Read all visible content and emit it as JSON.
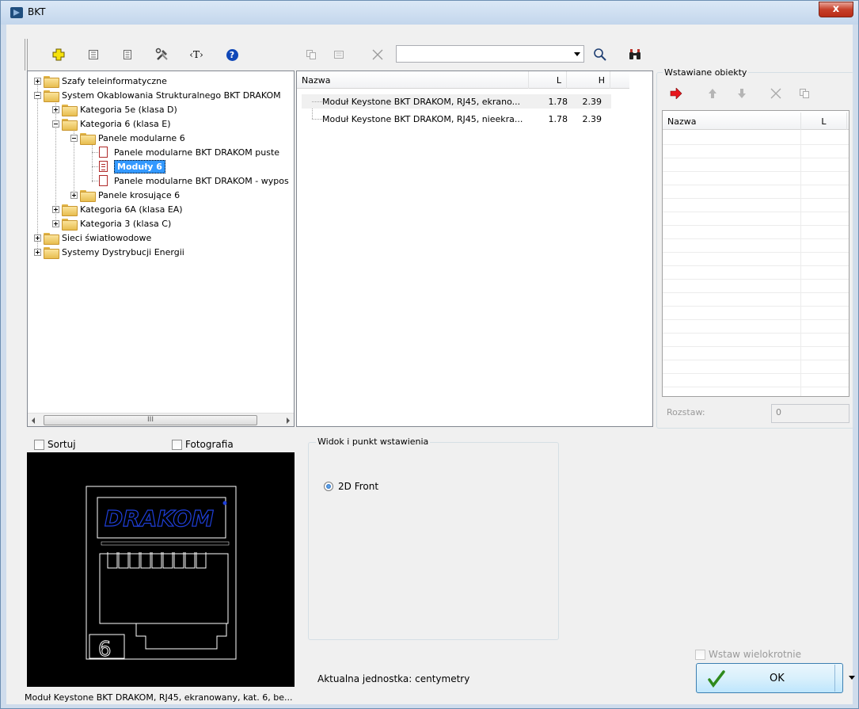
{
  "window": {
    "title": "BKT",
    "close_glyph": "x"
  },
  "toolbar": {
    "icons": [
      "add-icon",
      "list-view-icon",
      "details-icon",
      "tools-icon",
      "text-tag-icon",
      "help-icon",
      "copy-icon",
      "properties-icon",
      "delete-icon",
      "search-icon",
      "binoculars-icon"
    ],
    "text_tag": "‹T›",
    "help": "?",
    "search_value": ""
  },
  "tree": {
    "items": [
      {
        "label": "Szafy teleinformatyczne"
      },
      {
        "label": "System Okablowania Strukturalnego BKT DRAKOM"
      },
      {
        "label": "Kategoria 5e (klasa D)"
      },
      {
        "label": "Kategoria 6  (klasa E)"
      },
      {
        "label": "Panele modularne 6"
      },
      {
        "label": "Panele modularne BKT DRAKOM puste"
      },
      {
        "label": "Moduły 6"
      },
      {
        "label": "Panele modularne BKT DRAKOM - wypos"
      },
      {
        "label": "Panele krosujące 6"
      },
      {
        "label": "Kategoria 6A (klasa EA)"
      },
      {
        "label": "Kategoria 3 (klasa C)"
      },
      {
        "label": "Sieci światłowodowe"
      },
      {
        "label": "Systemy Dystrybucji Energii"
      }
    ],
    "scroll_thumb_glyph": "III"
  },
  "list": {
    "columns": [
      "Nazwa",
      "L",
      "H"
    ],
    "rows": [
      {
        "name": "Moduł Keystone BKT DRAKOM, RJ45, ekrano...",
        "l": "1.78",
        "h": "2.39"
      },
      {
        "name": "Moduł Keystone BKT DRAKOM, RJ45, nieekra...",
        "l": "1.78",
        "h": "2.39"
      }
    ]
  },
  "inserted": {
    "title": "Wstawiane obiekty",
    "columns": [
      "Nazwa",
      "L"
    ],
    "spacing_label": "Rozstaw:",
    "spacing_value": "0"
  },
  "options": {
    "sort_label": "Sortuj",
    "photo_label": "Fotografia"
  },
  "view": {
    "group_title": "Widok i punkt wstawienia",
    "option_2d_front": "2D Front"
  },
  "preview": {
    "brand": "DRAKOM",
    "category_digit": "6",
    "caption": "Moduł Keystone BKT DRAKOM, RJ45, ekranowany, kat. 6, be..."
  },
  "footer": {
    "unit_text": "Aktualna jednostka: centymetry",
    "multi_insert_label": "Wstaw wielokrotnie",
    "ok_label": "OK"
  },
  "colors": {
    "selection": "#3399ff",
    "preview_bg": "#000000",
    "preview_blue": "#1f3fd9",
    "close_red": "#c7402a"
  }
}
